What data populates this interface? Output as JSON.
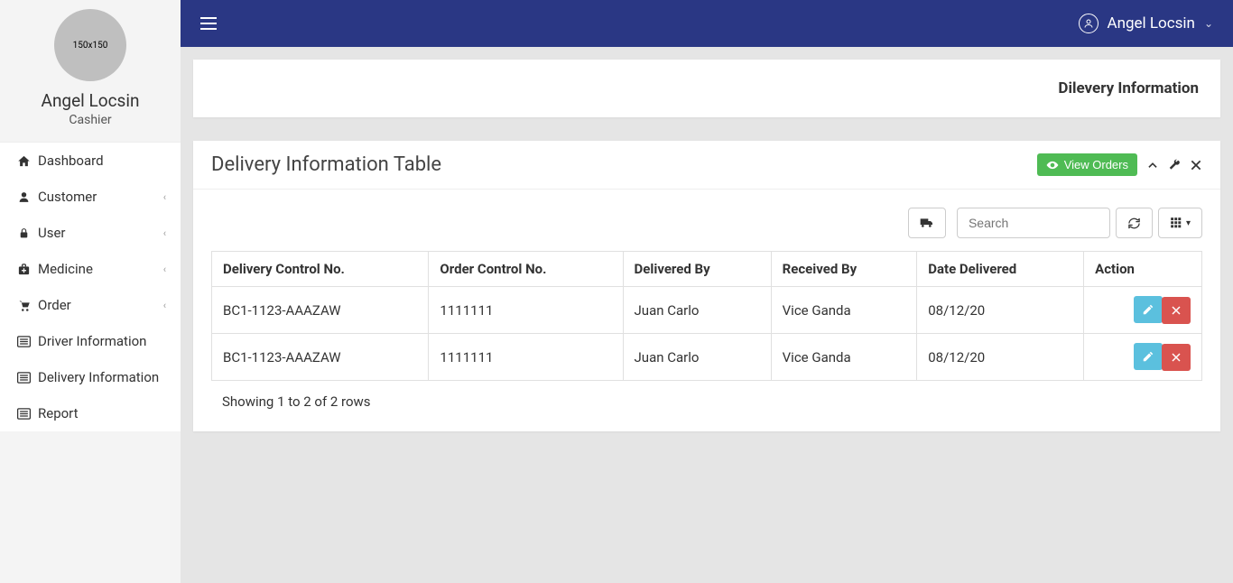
{
  "profile": {
    "avatar_text": "150x150",
    "name": "Angel Locsin",
    "role": "Cashier"
  },
  "topbar": {
    "user_name": "Angel Locsin"
  },
  "nav": {
    "items": [
      {
        "label": "Dashboard",
        "icon": "home",
        "expandable": false
      },
      {
        "label": "Customer",
        "icon": "user",
        "expandable": true
      },
      {
        "label": "User",
        "icon": "lock",
        "expandable": true
      },
      {
        "label": "Medicine",
        "icon": "medkit",
        "expandable": true
      },
      {
        "label": "Order",
        "icon": "cart",
        "expandable": true
      },
      {
        "label": "Driver Information",
        "icon": "list",
        "expandable": false
      },
      {
        "label": "Delivery Information",
        "icon": "list",
        "expandable": false
      },
      {
        "label": "Report",
        "icon": "list",
        "expandable": false
      }
    ]
  },
  "breadcrumb": {
    "title": "Dilevery Information"
  },
  "panel": {
    "title": "Delivery Information Table",
    "view_orders_label": "View Orders"
  },
  "toolbar": {
    "search_placeholder": "Search"
  },
  "table": {
    "columns": [
      "Delivery Control No.",
      "Order Control No.",
      "Delivered By",
      "Received By",
      "Date Delivered",
      "Action"
    ],
    "rows": [
      {
        "delivery_no": "BC1-1123-AAAZAW",
        "order_no": "1111111",
        "delivered_by": "Juan Carlo",
        "received_by": "Vice Ganda",
        "date": "08/12/20"
      },
      {
        "delivery_no": "BC1-1123-AAAZAW",
        "order_no": "1111111",
        "delivered_by": "Juan Carlo",
        "received_by": "Vice Ganda",
        "date": "08/12/20"
      }
    ],
    "footer": "Showing 1 to 2 of 2 rows"
  }
}
